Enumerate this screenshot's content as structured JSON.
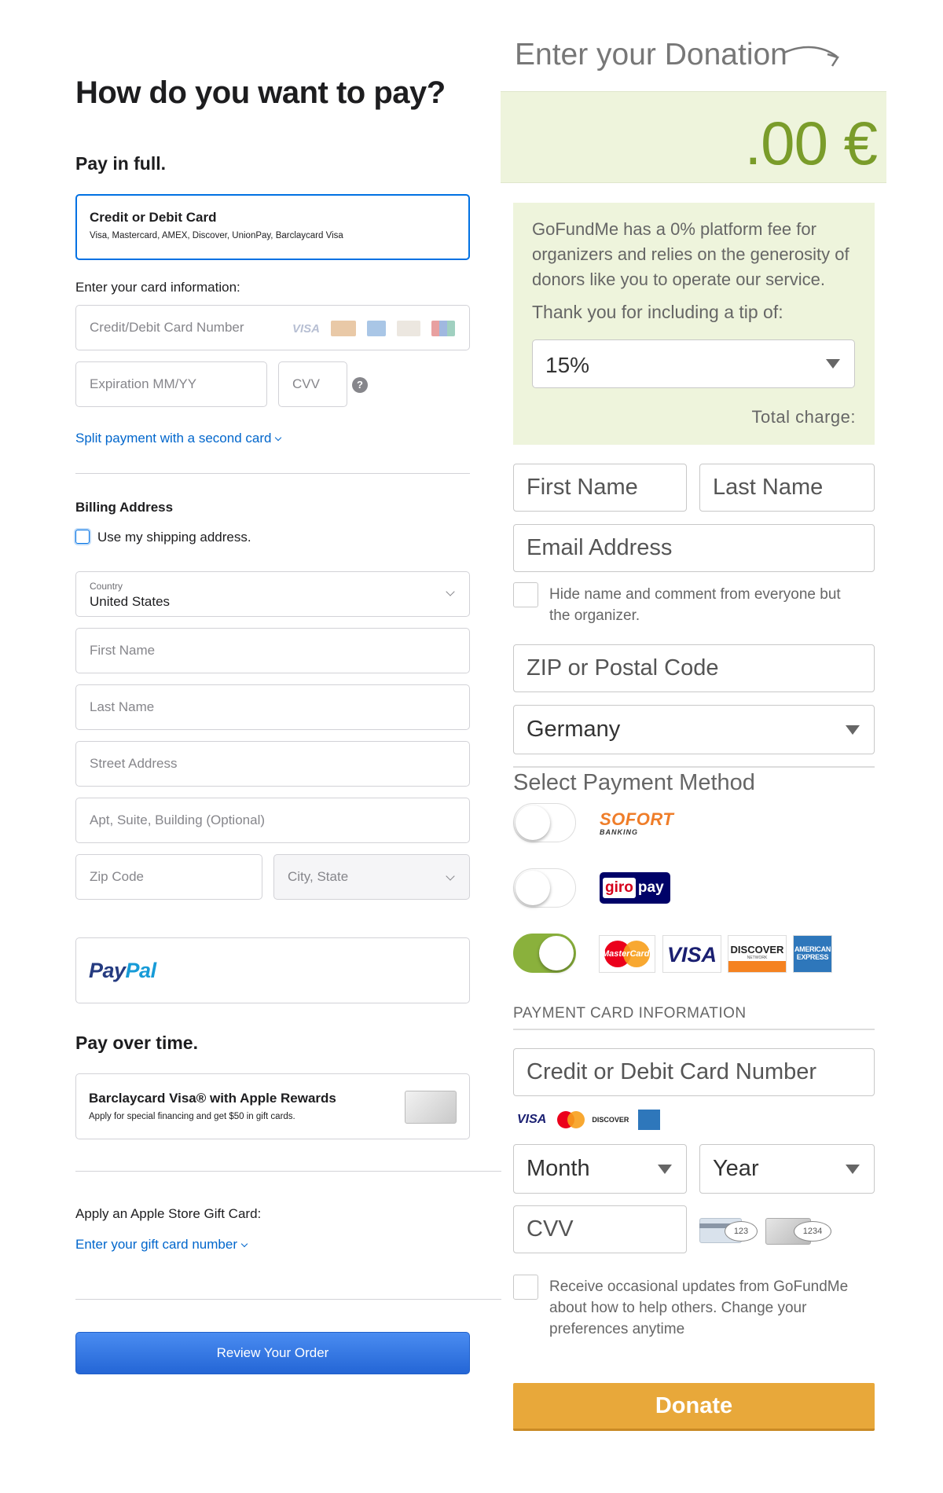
{
  "apple": {
    "title": "How do you want to pay?",
    "pay_in_full": "Pay in full.",
    "card_option": {
      "title": "Credit or Debit Card",
      "subtitle": "Visa, Mastercard, AMEX, Discover, UnionPay, Barclaycard Visa"
    },
    "card_info_label": "Enter your card information:",
    "card_number_placeholder": "Credit/Debit Card Number",
    "card_brands": [
      "VISA",
      "mastercard",
      "amex",
      "DISCOVER",
      "UnionPay"
    ],
    "expiration_placeholder": "Expiration MM/YY",
    "cvv_placeholder": "CVV",
    "cvv_help": "?",
    "split_payment_link": "Split payment with a second card",
    "billing_title": "Billing Address",
    "use_shipping_label": "Use my shipping address.",
    "country": {
      "label": "Country",
      "value": "United States"
    },
    "first_name_placeholder": "First Name",
    "last_name_placeholder": "Last Name",
    "street_placeholder": "Street Address",
    "apt_placeholder": "Apt, Suite, Building (Optional)",
    "zip_placeholder": "Zip Code",
    "city_placeholder": "City, State",
    "paypal_logo": {
      "pay": "Pay",
      "pal": "Pal"
    },
    "pay_over_time": "Pay over time.",
    "barclaycard": {
      "title": "Barclaycard Visa® with Apple Rewards",
      "subtitle": "Apply for special financing and get $50 in gift cards."
    },
    "gift_card_label": "Apply an Apple Store Gift Card:",
    "gift_card_link": "Enter your gift card number",
    "review_button": "Review Your Order"
  },
  "gofundme": {
    "donation_title": "Enter your Donation",
    "amount": ".00 €",
    "fee_text": "GoFundMe has a 0% platform fee for organizers and relies on the generosity of donors like you to operate our service.",
    "tip_label": "Thank you for including a tip of:",
    "tip_value": "15%",
    "total_charge": "Total charge:",
    "first_name": "First Name",
    "last_name": "Last Name",
    "email": "Email Address",
    "hide_name_text": "Hide name and comment from everyone but the organizer.",
    "zip": "ZIP or Postal Code",
    "country": "Germany",
    "payment_method_title": "Select Payment Method",
    "sofort": {
      "main": "SOFORT",
      "sub": "BANKING"
    },
    "giropay": {
      "giro": "giro",
      "pay": "pay"
    },
    "card_logos": [
      "MasterCard",
      "VISA",
      "DISCOVER",
      "AMERICAN EXPRESS"
    ],
    "card_logos_sub": [
      "NETWORK"
    ],
    "card_info_title": "PAYMENT CARD INFORMATION",
    "card_number": "Credit or Debit Card Number",
    "small_brands": [
      "VISA",
      "DISCOVER"
    ],
    "month": "Month",
    "year": "Year",
    "cvv": "CVV",
    "cvv_digits": [
      "123",
      "1234"
    ],
    "updates_text": "Receive occasional updates from GoFundMe about how to help others. Change your preferences anytime",
    "donate_button": "Donate",
    "colors": {
      "green": "#8ab13c",
      "light_green_bg": "#eef4dc",
      "donate_orange": "#e8a83a"
    }
  }
}
